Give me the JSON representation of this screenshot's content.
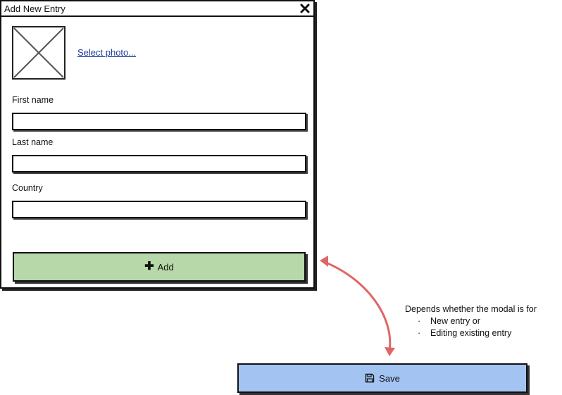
{
  "modal": {
    "title": "Add New Entry",
    "close_icon": "close-icon",
    "photo": {
      "placeholder_icon": "image-placeholder-icon",
      "select_link": "Select photo..."
    },
    "fields": {
      "first_name": {
        "label": "First name",
        "value": ""
      },
      "last_name": {
        "label": "Last name",
        "value": ""
      },
      "country": {
        "label": "Country",
        "value": ""
      }
    },
    "add_button": {
      "icon": "plus-icon",
      "label": "Add",
      "color": "#b7d8a8"
    }
  },
  "annotation": {
    "text": "Depends whether the modal is for",
    "items": [
      "New entry or",
      "Editing existing entry"
    ],
    "arrow_color": "#e06666"
  },
  "save_button": {
    "icon": "save-icon",
    "label": "Save",
    "color": "#a3c4f3"
  }
}
